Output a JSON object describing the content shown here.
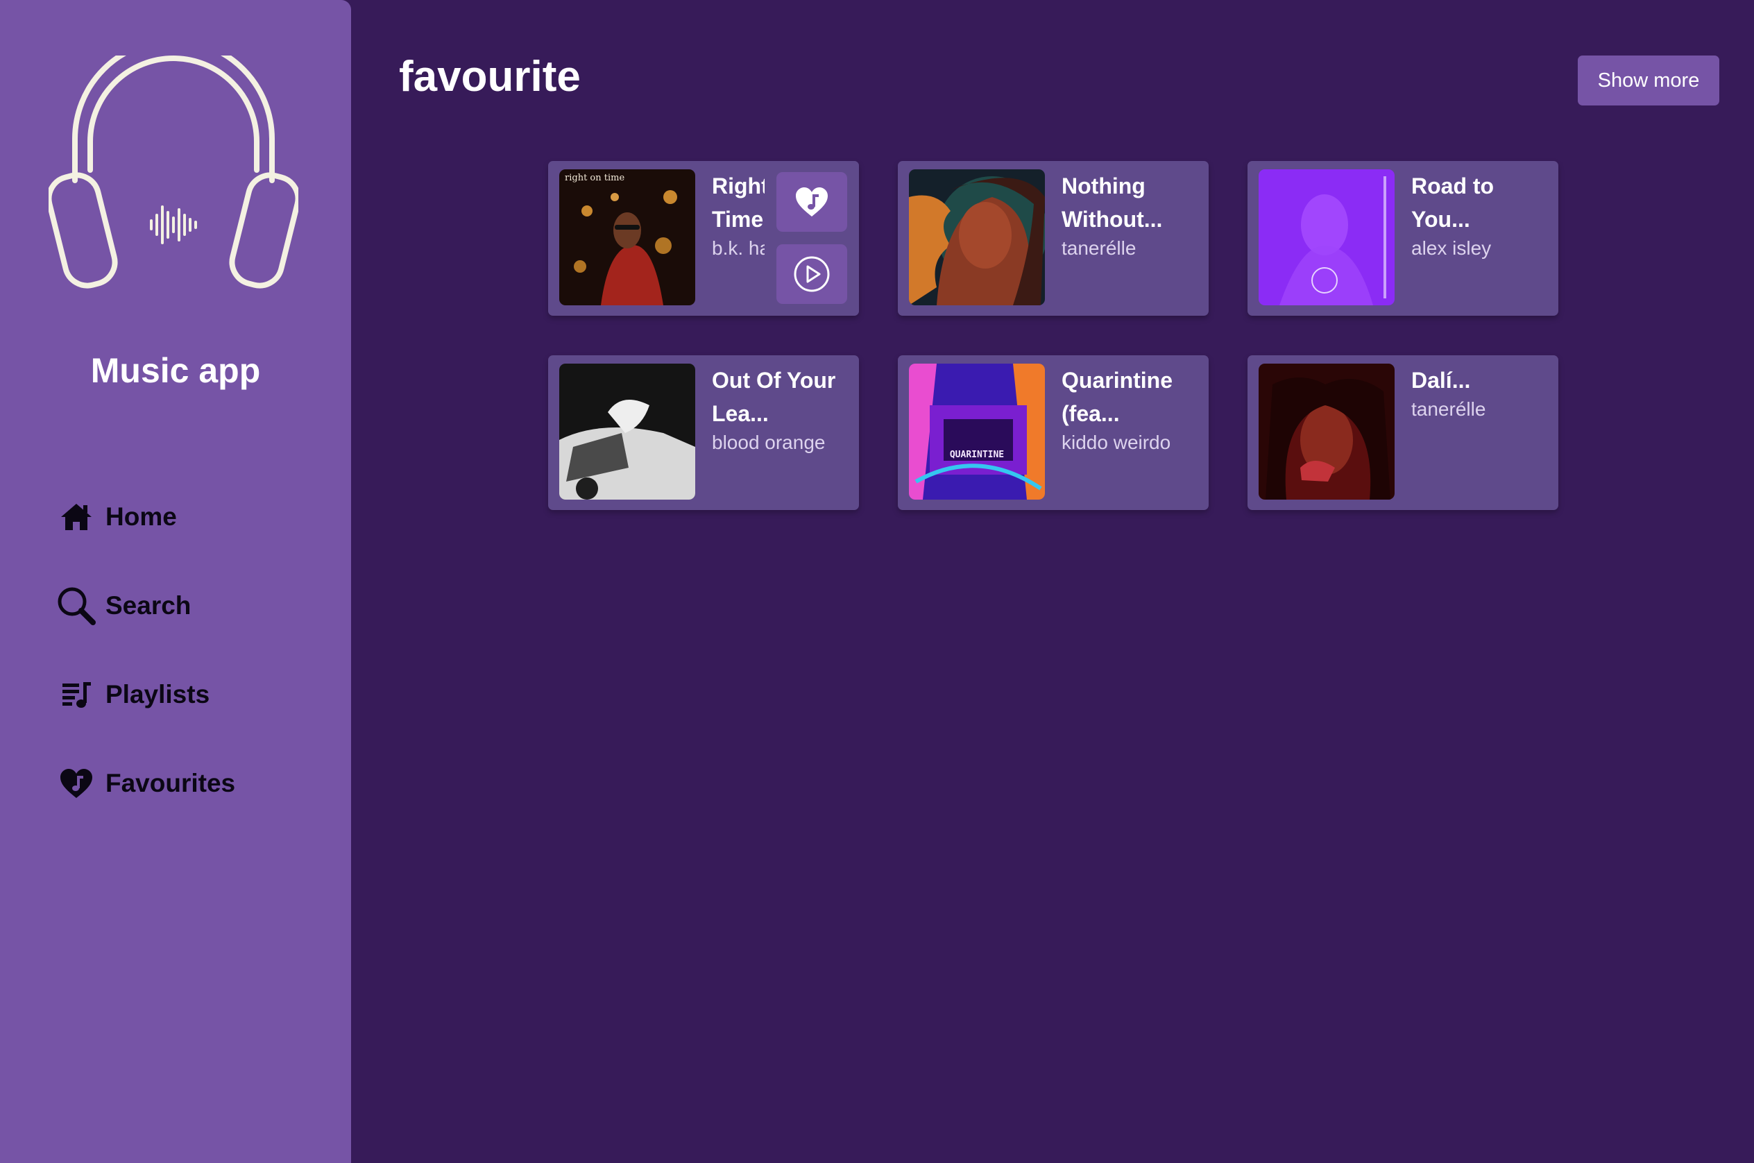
{
  "app": {
    "name": "Music app"
  },
  "nav": {
    "items": [
      {
        "label": "Home",
        "icon": "home-icon"
      },
      {
        "label": "Search",
        "icon": "search-icon"
      },
      {
        "label": "Playlists",
        "icon": "playlist-icon"
      },
      {
        "label": "Favourites",
        "icon": "heart-music-icon"
      }
    ]
  },
  "main": {
    "title": "favourite",
    "show_more_label": "Show more",
    "cards": [
      {
        "title": "Right\nTime (",
        "artist": "b.k. ha",
        "cover_text": "right on time",
        "hovered": true
      },
      {
        "title": "Nothing\nWithout...",
        "artist": "tanerélle"
      },
      {
        "title": "Road to\nYou...",
        "artist": "alex isley"
      },
      {
        "title": "Out Of Your\nLea...",
        "artist": "blood orange"
      },
      {
        "title": "Quarintine\n(fea...",
        "artist": "kiddo weirdo",
        "cover_text": "QUARINTINE"
      },
      {
        "title": "Dalí...",
        "artist": "tanerélle"
      }
    ]
  },
  "colors": {
    "background": "#371b59",
    "sidebar": "#7654a6",
    "card": "#5f4a8b",
    "accent": "#7654a6",
    "logo_stroke": "#f4f1e2"
  }
}
